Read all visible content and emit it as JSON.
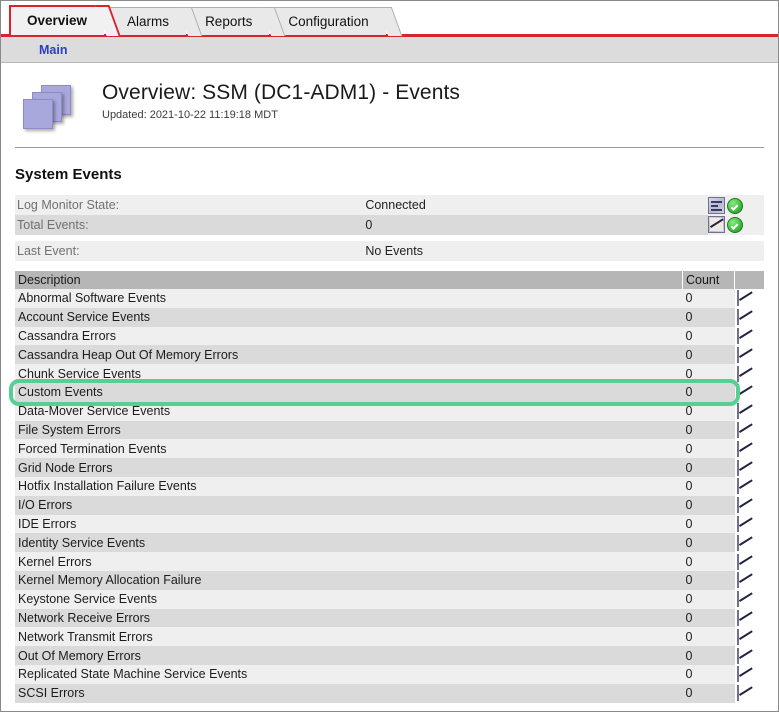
{
  "window": {
    "tabs": [
      {
        "label": "Overview",
        "active": true
      },
      {
        "label": "Alarms",
        "active": false
      },
      {
        "label": "Reports",
        "active": false
      },
      {
        "label": "Configuration",
        "active": false
      }
    ],
    "subnav": {
      "main_label": "Main"
    }
  },
  "header": {
    "title": "Overview: SSM (DC1-ADM1) - Events",
    "updated": "Updated: 2021-10-22 11:19:18 MDT",
    "icon": "stacked-panels-icon"
  },
  "section": {
    "title": "System Events"
  },
  "summary": {
    "rows": [
      {
        "label": "Log Monitor State:",
        "value": "Connected"
      },
      {
        "label": "Total Events:",
        "value": "0"
      },
      {
        "label": "Last Event:",
        "value": "No Events"
      }
    ],
    "status_icons": [
      {
        "name": "details-icon",
        "badge": "green-check-icon"
      },
      {
        "name": "chart-icon",
        "badge": "green-check-icon"
      }
    ]
  },
  "events_table": {
    "columns": [
      "Description",
      "Count",
      ""
    ],
    "row_icon": "chart-icon",
    "rows": [
      {
        "description": "Abnormal Software Events",
        "count": "0"
      },
      {
        "description": "Account Service Events",
        "count": "0"
      },
      {
        "description": "Cassandra Errors",
        "count": "0"
      },
      {
        "description": "Cassandra Heap Out Of Memory Errors",
        "count": "0"
      },
      {
        "description": "Chunk Service Events",
        "count": "0"
      },
      {
        "description": "Custom Events",
        "count": "0"
      },
      {
        "description": "Data-Mover Service Events",
        "count": "0"
      },
      {
        "description": "File System Errors",
        "count": "0"
      },
      {
        "description": "Forced Termination Events",
        "count": "0"
      },
      {
        "description": "Grid Node Errors",
        "count": "0"
      },
      {
        "description": "Hotfix Installation Failure Events",
        "count": "0"
      },
      {
        "description": "I/O Errors",
        "count": "0"
      },
      {
        "description": "IDE Errors",
        "count": "0"
      },
      {
        "description": "Identity Service Events",
        "count": "0"
      },
      {
        "description": "Kernel Errors",
        "count": "0"
      },
      {
        "description": "Kernel Memory Allocation Failure",
        "count": "0"
      },
      {
        "description": "Keystone Service Events",
        "count": "0"
      },
      {
        "description": "Network Receive Errors",
        "count": "0"
      },
      {
        "description": "Network Transmit Errors",
        "count": "0"
      },
      {
        "description": "Out Of Memory Errors",
        "count": "0"
      },
      {
        "description": "Replicated State Machine Service Events",
        "count": "0"
      },
      {
        "description": "SCSI Errors",
        "count": "0"
      }
    ]
  },
  "annotation": {
    "highlighted_row": "Custom Events",
    "color": "#57cf92"
  },
  "colors": {
    "accent_red": "#d8242f",
    "header_gray": "#b6b6b6",
    "row_odd": "#dadada",
    "row_even": "#efefef",
    "link_blue": "#2b3ec4",
    "icon_purple": "#a9a8dd"
  }
}
